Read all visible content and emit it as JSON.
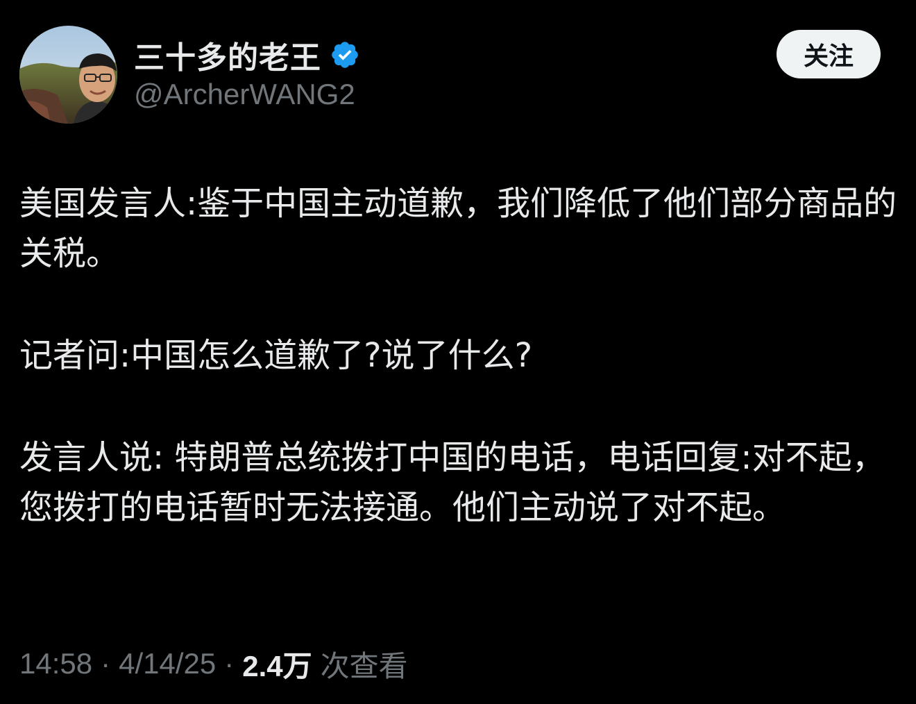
{
  "author": {
    "display_name": "三十多的老王",
    "handle": "@ArcherWANG2",
    "verified_icon": "verified-badge-icon",
    "verified_color": "#1d9bf0"
  },
  "actions": {
    "follow_label": "关注"
  },
  "tweet": {
    "paragraphs": [
      "美国发言人:鉴于中国主动道歉，我们降低了他们部分商品的关税。",
      "记者问:中国怎么道歉了?说了什么?",
      "发言人说: 特朗普总统拨打中国的电话，电话回复:对不起，您拨打的电话暂时无法接通。他们主动说了对不起。"
    ]
  },
  "meta": {
    "time": "14:58",
    "date": "4/14/25",
    "separator": "·",
    "views_count": "2.4万",
    "views_label": "次查看"
  },
  "colors": {
    "background": "#000000",
    "primary_text": "#e7e9ea",
    "secondary_text": "#71767b",
    "follow_button_bg": "#eff3f4",
    "follow_button_text": "#0f1419"
  }
}
